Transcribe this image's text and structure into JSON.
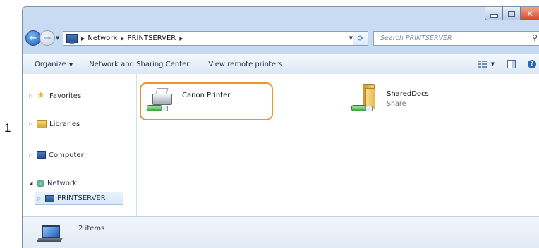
{
  "step_marker": "1",
  "window": {
    "caption": {
      "minimize": "–",
      "maximize": "□",
      "close": "✕"
    }
  },
  "address_bar": {
    "crumbs": [
      "Network",
      "PRINTSERVER"
    ],
    "search_placeholder": "Search PRINTSERVER"
  },
  "toolbar": {
    "organize_label": "Organize",
    "network_sharing_label": "Network and Sharing Center",
    "view_remote_printers_label": "View remote printers",
    "help_label": "?"
  },
  "nav_pane": {
    "items": [
      {
        "label": "Favorites",
        "icon": "star-icon"
      },
      {
        "label": "Libraries",
        "icon": "libraries-icon"
      },
      {
        "label": "Computer",
        "icon": "computer-icon"
      },
      {
        "label": "Network",
        "icon": "network-icon"
      },
      {
        "label": "PRINTSERVER",
        "icon": "server-icon",
        "selected": true
      }
    ]
  },
  "content": {
    "items": [
      {
        "name": "Canon Printer",
        "subtitle": "",
        "icon": "shared-printer-icon",
        "highlighted": true,
        "highlight_color": "#e8962f"
      },
      {
        "name": "SharedDocs",
        "subtitle": "Share",
        "icon": "shared-folder-icon",
        "highlighted": false
      }
    ]
  },
  "details": {
    "item_count_text": "2 items",
    "icon": "network-computer-icon"
  },
  "colors": {
    "title_bar": "#c9dcf2",
    "toolbar": "#dbe7f5",
    "selection": "#d7e7f8",
    "close_button": "#d24b2a"
  }
}
